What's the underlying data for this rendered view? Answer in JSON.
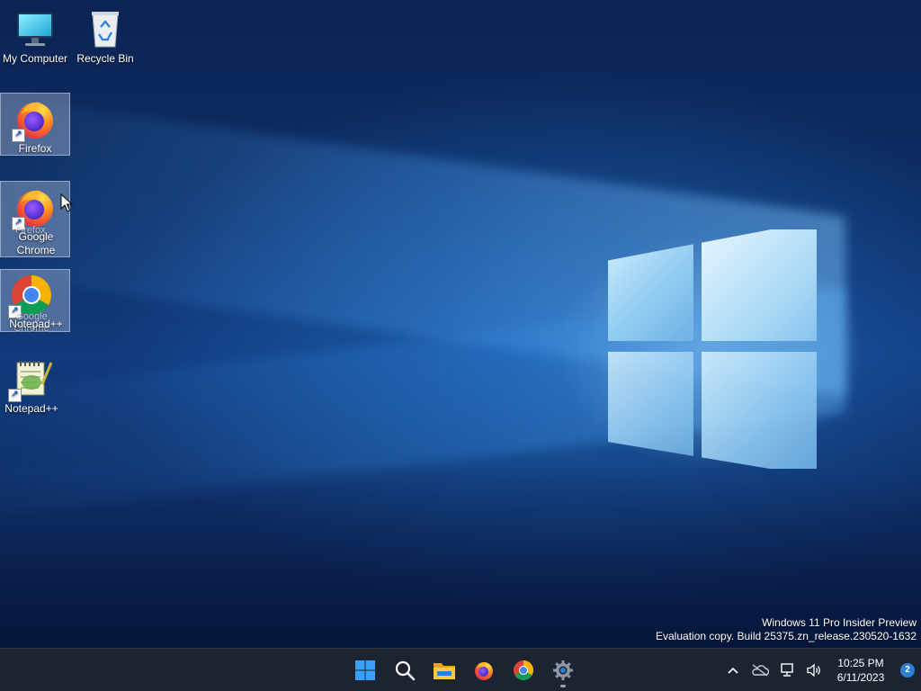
{
  "desktop": {
    "icons": [
      {
        "label": "My Computer"
      },
      {
        "label": "Recycle Bin"
      },
      {
        "label": "Firefox"
      },
      {
        "label": "Google Chrome"
      },
      {
        "label": "Notepad++"
      }
    ],
    "drag_ghosts": {
      "firefox": "Firefox",
      "chrome": "Google Chrome",
      "notepad": "Notepad++"
    },
    "watermark": {
      "line1": "Windows 11 Pro Insider Preview",
      "line2": "Evaluation copy. Build 25375.zn_release.230520-1632"
    }
  },
  "taskbar": {
    "apps": [
      {
        "name": "start-button",
        "icon": "windows-logo-icon"
      },
      {
        "name": "search-button",
        "icon": "search-icon"
      },
      {
        "name": "file-explorer-button",
        "icon": "folder-icon"
      },
      {
        "name": "firefox-button",
        "icon": "firefox-icon"
      },
      {
        "name": "chrome-button",
        "icon": "chrome-icon"
      },
      {
        "name": "settings-button",
        "icon": "gear-icon",
        "running": true
      }
    ],
    "tray": {
      "time": "10:25 PM",
      "date": "6/11/2023",
      "notification_count": "2"
    }
  },
  "colors": {
    "taskbar_bg": "#1c2331",
    "accent": "#2b7fd8",
    "wallpaper_dark": "#0b2352"
  }
}
